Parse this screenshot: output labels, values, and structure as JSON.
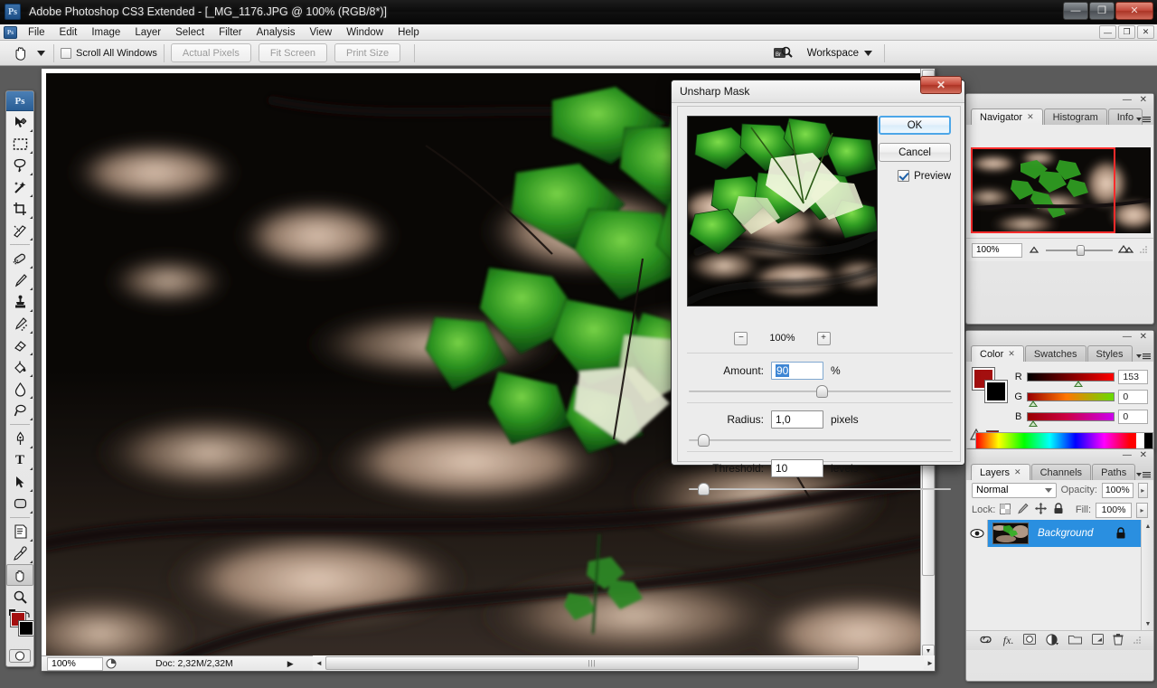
{
  "window": {
    "title": "Adobe Photoshop CS3 Extended - [_MG_1176.JPG @ 100% (RGB/8*)]",
    "app_badge": "Ps",
    "buttons": {
      "minimize": "—",
      "restore": "❐",
      "close": "✕"
    }
  },
  "menubar": {
    "badge": "Ps",
    "items": [
      "File",
      "Edit",
      "Image",
      "Layer",
      "Select",
      "Filter",
      "Analysis",
      "View",
      "Window",
      "Help"
    ],
    "doc_buttons": {
      "minimize": "—",
      "restore": "❐",
      "close": "✕"
    }
  },
  "options_bar": {
    "tool_icon": "hand-tool-icon",
    "preset_caret": "chevron-down-icon",
    "scroll_all_windows": "Scroll All Windows",
    "actual_pixels": "Actual Pixels",
    "fit_screen": "Fit Screen",
    "print_size": "Print Size",
    "bridge_icon": "go-to-bridge-icon",
    "workspace": "Workspace",
    "workspace_caret": "▼"
  },
  "toolbox": {
    "header": "Ps",
    "tools": [
      {
        "name": "move-tool",
        "glyph": "move"
      },
      {
        "name": "marquee-tool",
        "glyph": "marquee"
      },
      {
        "name": "lasso-tool",
        "glyph": "lasso"
      },
      {
        "name": "magic-wand-tool",
        "glyph": "wand"
      },
      {
        "name": "crop-tool",
        "glyph": "crop"
      },
      {
        "name": "slice-tool",
        "glyph": "slice"
      },
      {
        "name": "healing-brush-tool",
        "glyph": "heal"
      },
      {
        "name": "brush-tool",
        "glyph": "brush"
      },
      {
        "name": "clone-stamp-tool",
        "glyph": "stamp"
      },
      {
        "name": "history-brush-tool",
        "glyph": "history"
      },
      {
        "name": "eraser-tool",
        "glyph": "eraser"
      },
      {
        "name": "gradient-tool",
        "glyph": "bucket"
      },
      {
        "name": "blur-tool",
        "glyph": "blur"
      },
      {
        "name": "dodge-tool",
        "glyph": "dodge"
      },
      {
        "name": "pen-tool",
        "glyph": "pen"
      },
      {
        "name": "type-tool",
        "glyph": "T"
      },
      {
        "name": "path-selection-tool",
        "glyph": "arrow"
      },
      {
        "name": "rectangle-tool",
        "glyph": "rect"
      },
      {
        "name": "notes-tool",
        "glyph": "note"
      },
      {
        "name": "eyedropper-tool",
        "glyph": "dropper"
      },
      {
        "name": "hand-tool",
        "glyph": "hand"
      },
      {
        "name": "zoom-tool",
        "glyph": "zoom"
      }
    ],
    "foreground_color": "#a30f0f",
    "background_color": "#000000",
    "quick_mask": "quick-mask-icon",
    "screen_mode": "screen-mode-icon"
  },
  "document": {
    "status": {
      "zoom": "100%",
      "doc_info": "Doc: 2,32M/2,32M",
      "arrow": "▶"
    }
  },
  "navigator_panel": {
    "tabs": [
      {
        "label": "Navigator",
        "active": true,
        "closeable": true
      },
      {
        "label": "Histogram",
        "active": false,
        "closeable": false
      },
      {
        "label": "Info",
        "active": false,
        "closeable": false
      }
    ],
    "zoom_value": "100%",
    "menu_icon": "panel-menu-icon",
    "view_box_color": "#ff2b2b"
  },
  "color_panel": {
    "tabs": [
      {
        "label": "Color",
        "active": true,
        "closeable": true
      },
      {
        "label": "Swatches",
        "active": false,
        "closeable": false
      },
      {
        "label": "Styles",
        "active": false,
        "closeable": false
      }
    ],
    "foreground_color": "#a30f0f",
    "background_color": "#000000",
    "channels": [
      {
        "label": "R",
        "value": "153"
      },
      {
        "label": "G",
        "value": "0"
      },
      {
        "label": "B",
        "value": "0"
      }
    ],
    "gamut_warning_icon": "out-of-gamut-warning-icon",
    "gamut_swatch": "#a30f0f"
  },
  "layers_panel": {
    "tabs": [
      {
        "label": "Layers",
        "active": true,
        "closeable": true
      },
      {
        "label": "Channels",
        "active": false,
        "closeable": false
      },
      {
        "label": "Paths",
        "active": false,
        "closeable": false
      }
    ],
    "blend_mode": "Normal",
    "opacity_label": "Opacity:",
    "opacity_value": "100%",
    "lock_label": "Lock:",
    "fill_label": "Fill:",
    "fill_value": "100%",
    "lock_icons": [
      "lock-transparency-icon",
      "lock-image-icon",
      "lock-position-icon",
      "lock-all-icon"
    ],
    "layers": [
      {
        "name": "Background",
        "visible": true,
        "locked": true,
        "selected": true
      }
    ],
    "footer_icons": [
      "link-layers-icon",
      "layer-style-fx-icon",
      "layer-mask-icon",
      "adjustment-layer-icon",
      "new-group-icon",
      "new-layer-icon",
      "delete-layer-icon"
    ],
    "footer_fx_label": "fx"
  },
  "dialog": {
    "title": "Unsharp Mask",
    "close_glyph": "✕",
    "ok_label": "OK",
    "cancel_label": "Cancel",
    "preview_label": "Preview",
    "preview_checked": true,
    "zoom_out_glyph": "−",
    "zoom_in_glyph": "+",
    "zoom_percent": "100%",
    "fields": [
      {
        "name": "amount",
        "label": "Amount:",
        "value": "90",
        "unit": "%",
        "slider_pct": 50,
        "selected": true
      },
      {
        "name": "radius",
        "label": "Radius:",
        "value": "1,0",
        "unit": "pixels",
        "slider_pct": 4,
        "selected": false
      },
      {
        "name": "threshold",
        "label": "Threshold:",
        "value": "10",
        "unit": "levels",
        "slider_pct": 4,
        "selected": false
      }
    ]
  }
}
